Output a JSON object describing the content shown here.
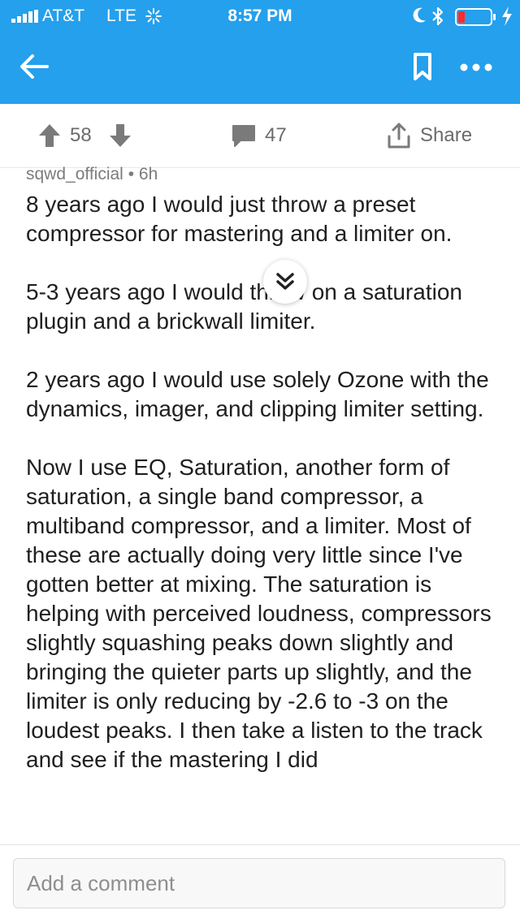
{
  "status_bar": {
    "carrier": "AT&T",
    "network": "LTE",
    "time": "8:57 PM",
    "icons": [
      "signal-icon",
      "loading-icon",
      "moon-icon",
      "bluetooth-icon",
      "battery-icon",
      "charging-icon"
    ]
  },
  "header": {
    "background_color": "#24a0ed",
    "icons": [
      "back-arrow-icon",
      "bookmark-icon",
      "more-icon"
    ]
  },
  "actions": {
    "upvotes": "58",
    "comments": "47",
    "share_label": "Share"
  },
  "comment": {
    "author": "sqwd_official",
    "separator": "•",
    "age": "6h",
    "paragraphs": [
      "8 years ago I would just throw a preset compressor for mastering and a limiter on.",
      "5-3 years ago I would throw on a saturation plugin and a brickwall limiter.",
      "2 years ago I would use solely Ozone with the dynamics, imager, and clipping limiter setting.",
      "Now I use EQ, Saturation, another form of saturation, a single band compressor, a multiband compressor, and a limiter. Most of these are actually doing very little since I've gotten better at mixing.  The saturation is helping with perceived loudness, compressors slightly squashing peaks down slightly and bringing the quieter parts up slightly, and the limiter is only reducing by -2.6 to -3 on the loudest peaks.  I then take a listen to the track and see if the mastering I did"
    ]
  },
  "input": {
    "placeholder": "Add a comment"
  }
}
